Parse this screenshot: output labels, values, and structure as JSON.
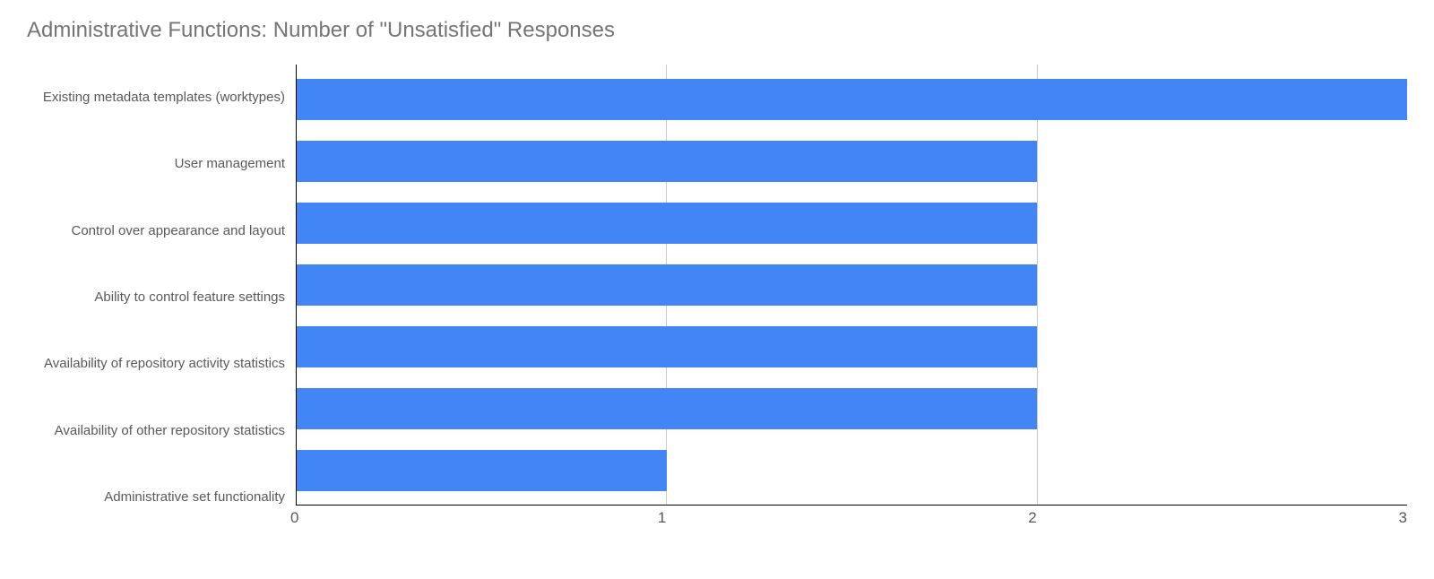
{
  "chart_data": {
    "type": "bar",
    "orientation": "horizontal",
    "title": "Administrative Functions: Number of \"Unsatisfied\" Responses",
    "categories": [
      "Existing metadata templates (worktypes)",
      "User management",
      "Control over appearance and layout",
      "Ability to control feature settings",
      "Availability of repository activity statistics",
      "Availability of other repository statistics",
      "Administrative set functionality"
    ],
    "values": [
      3,
      2,
      2,
      2,
      2,
      2,
      1
    ],
    "xlabel": "",
    "ylabel": "",
    "xlim": [
      0,
      3
    ],
    "x_ticks": [
      0,
      1,
      2,
      3
    ],
    "bar_color": "#4285f4",
    "grid": true
  }
}
